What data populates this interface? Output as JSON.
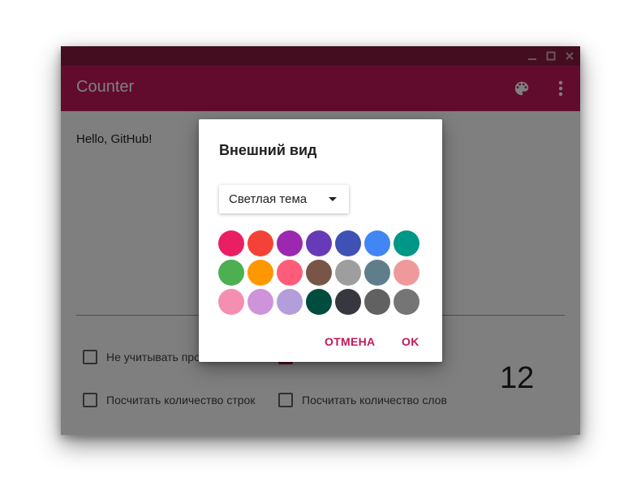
{
  "window": {
    "controls": [
      "minimize-icon",
      "maximize-icon",
      "close-icon"
    ]
  },
  "appbar": {
    "title": "Counter",
    "icons": [
      "palette-icon",
      "more-vert-icon"
    ],
    "accent": "#c2185b",
    "titlebar_color": "#881a41"
  },
  "editor": {
    "text": "Hello, GitHub!"
  },
  "options": {
    "ignore_spaces": {
      "label": "Не учитывать пробелы",
      "checked": false
    },
    "hidden_option": {
      "label": "",
      "checked": true
    },
    "count_lines": {
      "label": "Посчитать количество строк",
      "checked": false
    },
    "count_words": {
      "label": "Посчитать количество слов",
      "checked": false
    }
  },
  "counter": {
    "value": "12"
  },
  "dialog": {
    "title": "Внешний вид",
    "theme_select": {
      "selected": "Светлая тема"
    },
    "palette": [
      "#e91e63",
      "#f44336",
      "#9c27b0",
      "#673ab7",
      "#3f51b5",
      "#4285f4",
      "#009688",
      "#4caf50",
      "#ff9800",
      "#ff5c7a",
      "#795548",
      "#9e9e9e",
      "#607d8b",
      "#ef9a9a",
      "#f48fb1",
      "#ce93d8",
      "#b39ddb",
      "#004d40",
      "#37373f",
      "#616161",
      "#757575"
    ],
    "cancel_label": "ОТМЕНА",
    "ok_label": "OK"
  }
}
